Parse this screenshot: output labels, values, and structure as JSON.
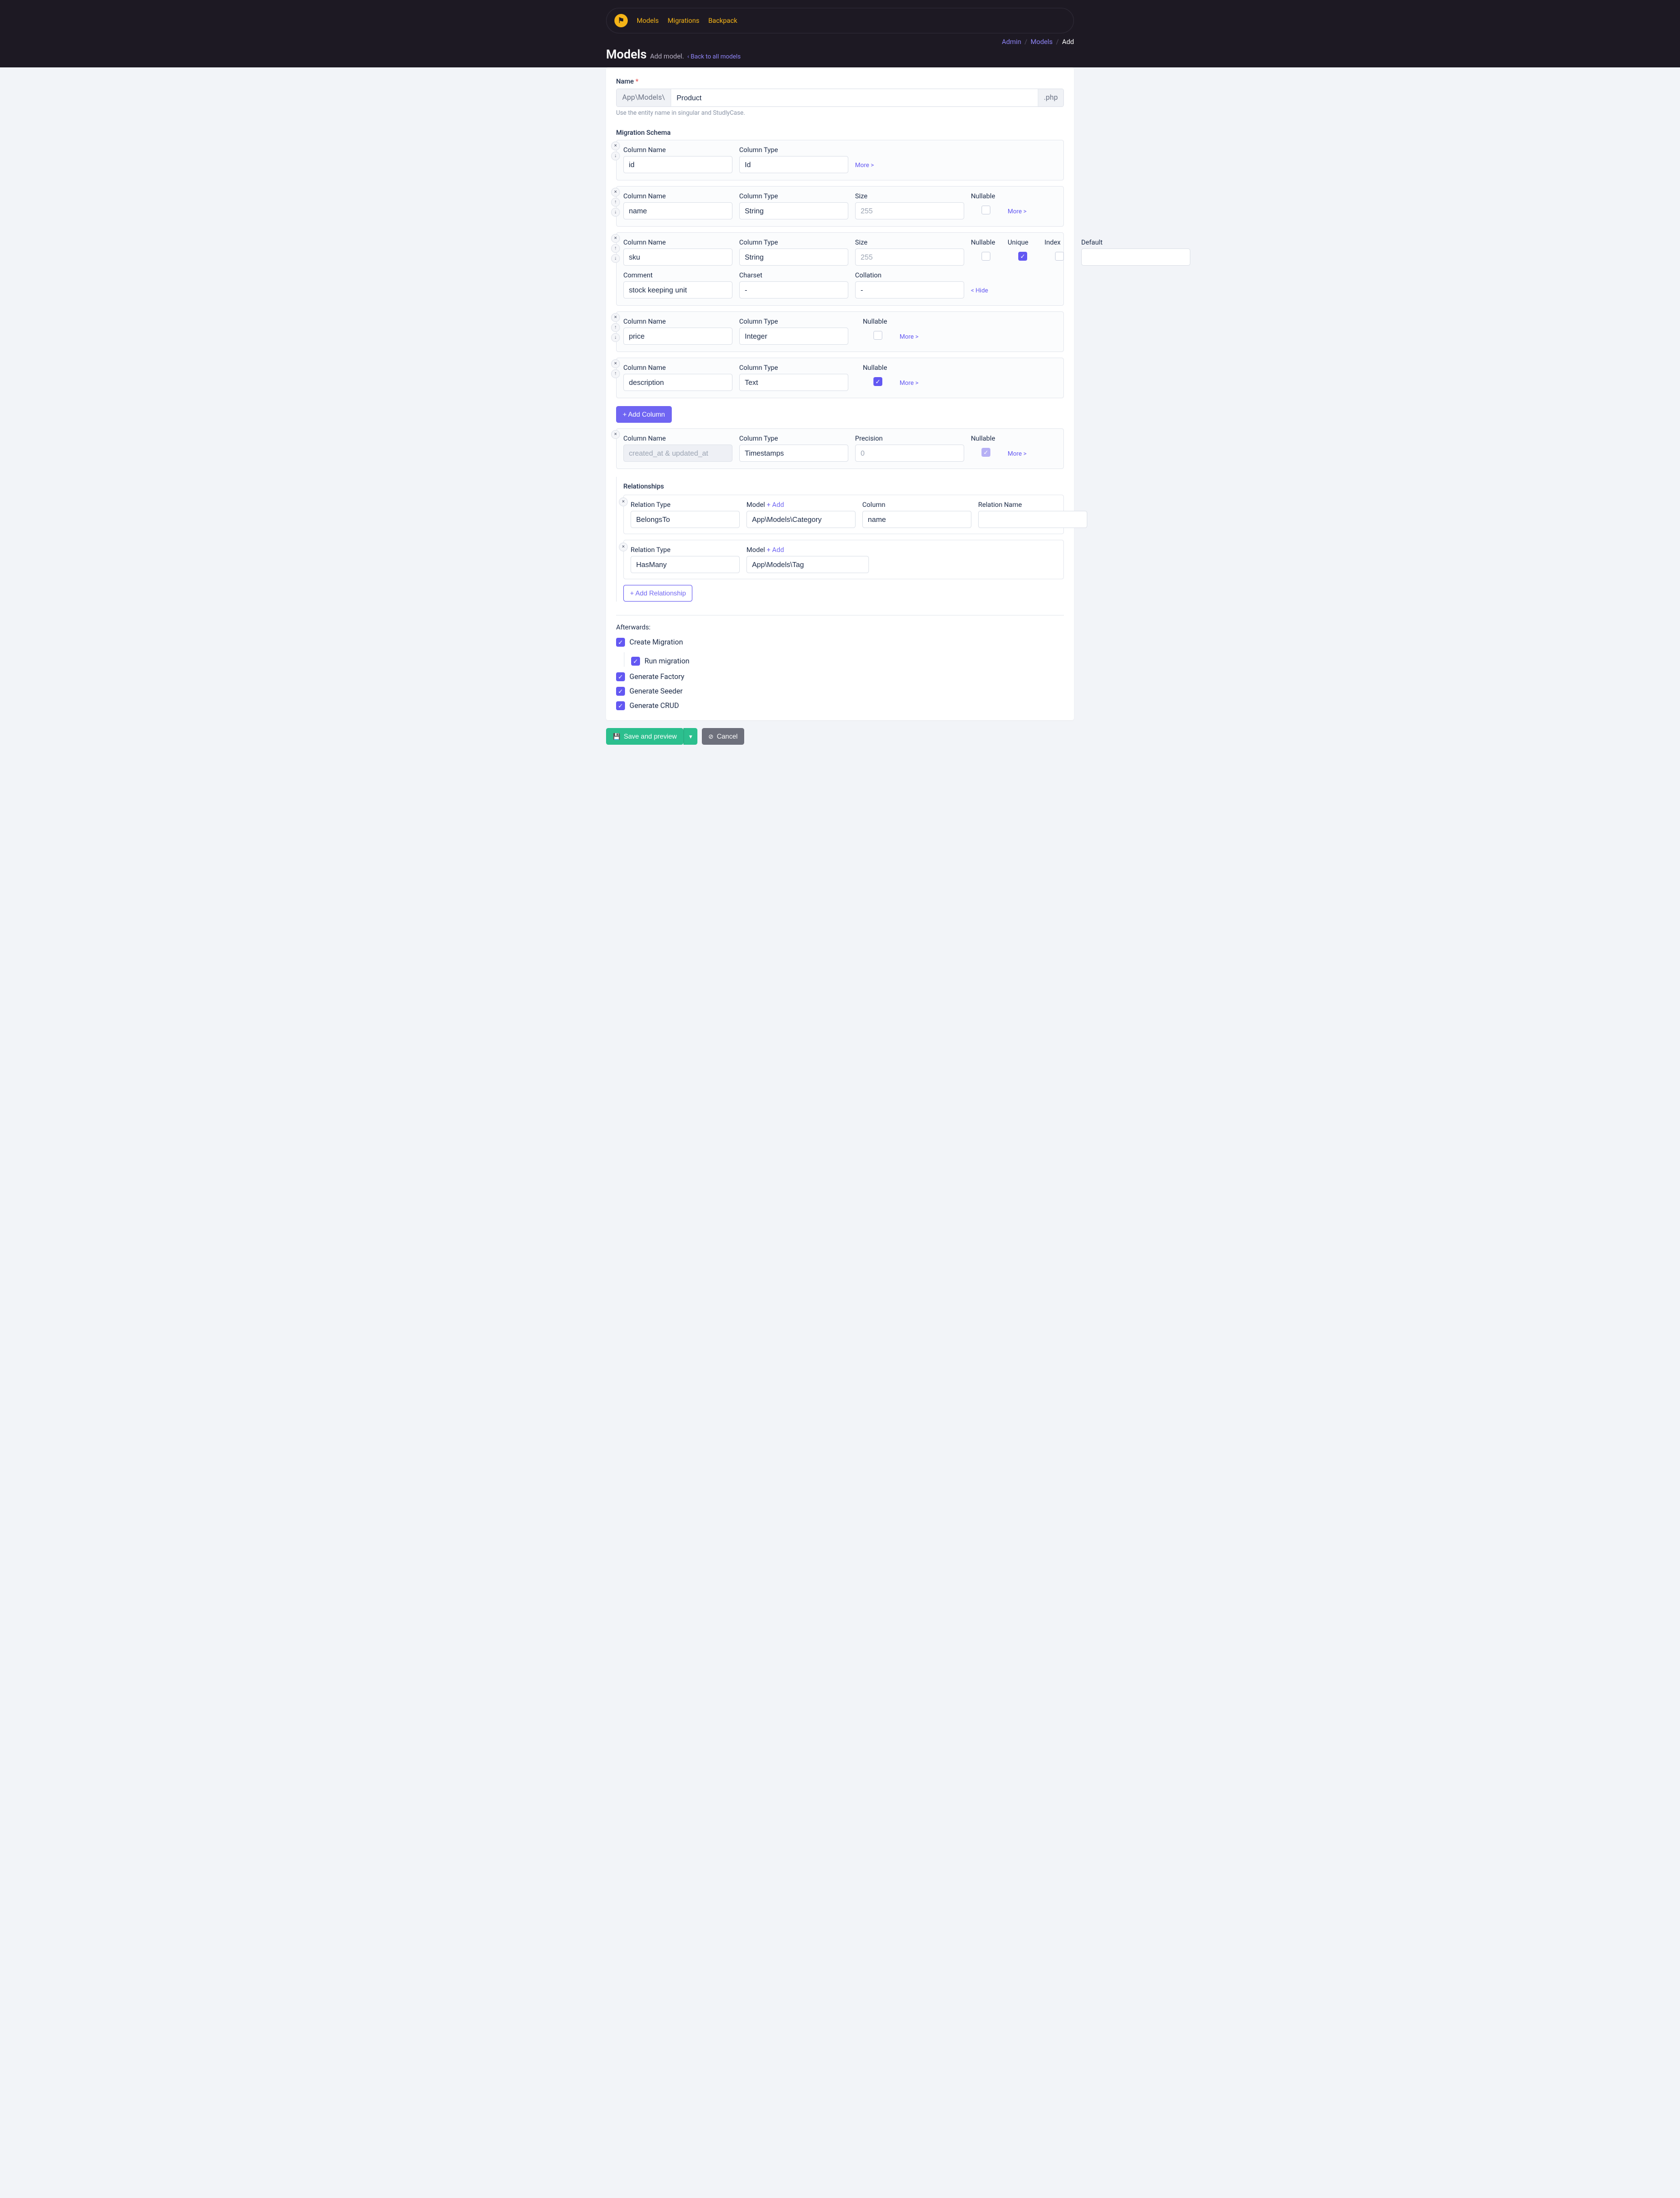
{
  "nav": {
    "items": [
      "Models",
      "Migrations",
      "Backpack"
    ]
  },
  "breadcrumbs": {
    "admin": "Admin",
    "models": "Models",
    "current": "Add"
  },
  "header": {
    "title": "Models",
    "subtitle": "Add model.",
    "back": "‹  Back to all models"
  },
  "name_field": {
    "label": "Name",
    "prefix": "App\\Models\\",
    "value": "Product",
    "suffix": ".php",
    "helper": "Use the entity name in singular and StudlyCase."
  },
  "schema": {
    "label": "Migration Schema",
    "labels": {
      "column_name": "Column Name",
      "column_type": "Column Type",
      "size": "Size",
      "nullable": "Nullable",
      "unique": "Unique",
      "index": "Index",
      "default": "Default",
      "comment": "Comment",
      "charset": "Charset",
      "collation": "Collation",
      "precision": "Precision",
      "more": "More >",
      "hide": "< Hide"
    },
    "size_placeholder": "255",
    "precision_placeholder": "0",
    "cols": [
      {
        "name": "id",
        "type": "Id",
        "more": true
      },
      {
        "name": "name",
        "type": "String",
        "size": "",
        "nullable": false,
        "more": true
      },
      {
        "name": "sku",
        "type": "String",
        "size": "",
        "nullable": false,
        "unique": true,
        "index": false,
        "default": "",
        "comment": "stock keeping unit",
        "charset": "-",
        "collation": "-",
        "expanded": true
      },
      {
        "name": "price",
        "type": "Integer",
        "nullable": false,
        "more": true
      },
      {
        "name": "description",
        "type": "Text",
        "nullable": true,
        "more": true
      }
    ],
    "add_btn": "+ Add Column",
    "timestamps": {
      "placeholder": "created_at & updated_at",
      "type": "Timestamps",
      "precision": "",
      "nullable_locked": true
    }
  },
  "relationships": {
    "heading": "Relationships",
    "labels": {
      "type": "Relation Type",
      "model": "Model",
      "add": "+ Add",
      "column": "Column",
      "name": "Relation Name"
    },
    "items": [
      {
        "type": "BelongsTo",
        "model": "App\\Models\\Category",
        "column": "name",
        "name": ""
      },
      {
        "type": "HasMany",
        "model": "App\\Models\\Tag"
      }
    ],
    "add_btn": "+ Add Relationship"
  },
  "afterwards": {
    "heading": "Afterwards:",
    "items": {
      "create_migration": "Create Migration",
      "run_migration": "Run migration",
      "generate_factory": "Generate Factory",
      "generate_seeder": "Generate Seeder",
      "generate_crud": "Generate CRUD"
    }
  },
  "actions": {
    "save": "Save and preview",
    "cancel": "Cancel"
  }
}
